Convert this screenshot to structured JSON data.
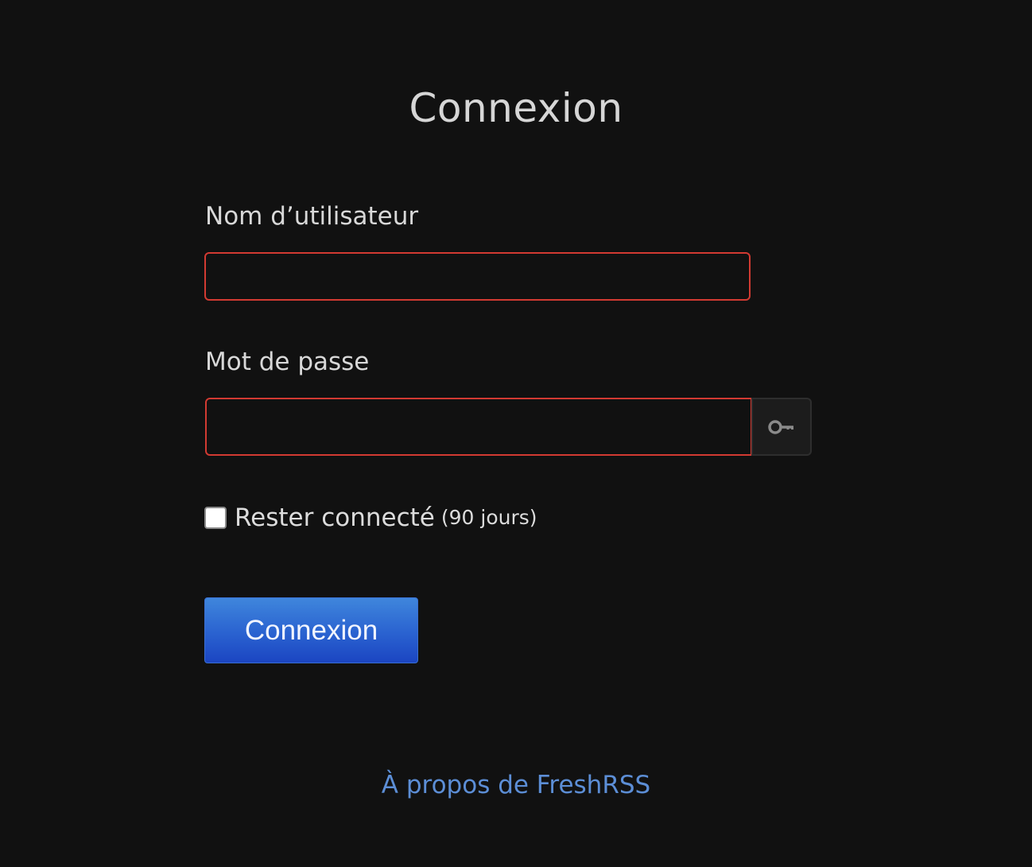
{
  "page": {
    "title": "Connexion"
  },
  "form": {
    "username_label": "Nom d’utilisateur",
    "username_value": "",
    "password_label": "Mot de passe",
    "password_value": "",
    "show_password_icon": "key-icon",
    "remember_label": "Rester connecté",
    "remember_note": "(90 jours)",
    "remember_checked": false,
    "submit_label": "Connexion"
  },
  "footer": {
    "about_link": "À propos de FreshRSS"
  },
  "colors": {
    "background": "#111111",
    "invalid_border": "#d23a32",
    "primary_button": "#2a62d0",
    "link": "#5c8ed6"
  }
}
